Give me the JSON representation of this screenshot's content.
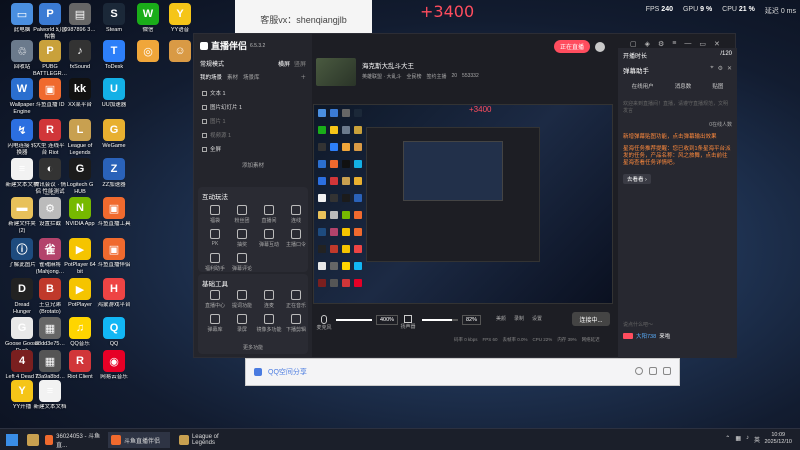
{
  "overlay": {
    "cs_text": "客服vx：shenqiangjlb",
    "big_number": "+3400",
    "perf": {
      "fps_label": "FPS",
      "fps": "240",
      "gpu_label": "GPU",
      "gpu": "9 %",
      "cpu_label": "CPU",
      "cpu": "21 %",
      "delay": "延迟 0 ms"
    }
  },
  "desktop_icons": [
    {
      "label": "此电脑",
      "color": "#4a8fe0",
      "glyph": "▭"
    },
    {
      "label": "Palworld 幻兽帕鲁",
      "color": "#3b7bd4",
      "glyph": "P"
    },
    {
      "label": "0987896 3…",
      "color": "#666",
      "glyph": "▤"
    },
    {
      "label": "Steam",
      "color": "#1b2838",
      "glyph": "S"
    },
    {
      "label": "微信",
      "color": "#1aad19",
      "glyph": "W"
    },
    {
      "label": "YY语音",
      "color": "#f5c518",
      "glyph": "Y"
    },
    {
      "label": "回收站",
      "color": "#6b7a8c",
      "glyph": "♲"
    },
    {
      "label": "PUBG BATTLEGR…",
      "color": "#c9a13b",
      "glyph": "P"
    },
    {
      "label": "fxSound",
      "color": "#333",
      "glyph": "♪"
    },
    {
      "label": "ToDesk",
      "color": "#2d7ff9",
      "glyph": "T"
    },
    {
      "label": "",
      "color": "#f0a63a",
      "glyph": "◎"
    },
    {
      "label": "",
      "color": "#d99a45",
      "glyph": "☺"
    },
    {
      "label": "Wallpaper Engine",
      "color": "#2b6fcf",
      "glyph": "W"
    },
    {
      "label": "斗鱼直播 ID",
      "color": "#f06a2e",
      "glyph": "▣"
    },
    {
      "label": "XX某平台",
      "color": "#111",
      "glyph": "kk"
    },
    {
      "label": "UU加速器",
      "color": "#13b0e6",
      "glyph": "U"
    },
    {
      "label": "闪电连接 转换器",
      "color": "#2c6fe0",
      "glyph": "↯"
    },
    {
      "label": "大型 连线平台 Riot",
      "color": "#d13639",
      "glyph": "R"
    },
    {
      "label": "League of Legends",
      "color": "#c8a050",
      "glyph": "L"
    },
    {
      "label": "WeGame",
      "color": "#e8b030",
      "glyph": "G"
    },
    {
      "label": "新建文本文档",
      "color": "#f2f2f2",
      "glyph": "≡"
    },
    {
      "label": "腾讯会议 · 情侣 性能测试工具",
      "color": "#333",
      "glyph": "◐"
    },
    {
      "label": "Logitech G HUB",
      "color": "#1b1b1b",
      "glyph": "G"
    },
    {
      "label": "ZZ加速器",
      "color": "#2a62b9",
      "glyph": "Z"
    },
    {
      "label": "新建文件夹 (2)",
      "color": "#e8c15a",
      "glyph": "▬"
    },
    {
      "label": "设置拦截",
      "color": "#bbb",
      "glyph": "⚙"
    },
    {
      "label": "NVIDIA App",
      "color": "#76b900",
      "glyph": "N"
    },
    {
      "label": "斗鱼直播工具",
      "color": "#f06a2e",
      "glyph": "▣"
    },
    {
      "label": "了解此图片",
      "color": "#1e4b7e",
      "glyph": "ⓘ"
    },
    {
      "label": "雀魂麻将 (Mahjong…",
      "color": "#b3436b",
      "glyph": "雀"
    },
    {
      "label": "PotPlayer 64 bit",
      "color": "#f5c400",
      "glyph": "▶"
    },
    {
      "label": "斗鱼直播伴侣",
      "color": "#f06a2e",
      "glyph": "▣"
    },
    {
      "label": "Dread Hunger",
      "color": "#222",
      "glyph": "D"
    },
    {
      "label": "土豆兄弟 (Brotato)",
      "color": "#c0392b",
      "glyph": "B"
    },
    {
      "label": "PotPlayer",
      "color": "#f5c400",
      "glyph": "▶"
    },
    {
      "label": "鸿蒙游戏平台",
      "color": "#e44",
      "glyph": "H"
    },
    {
      "label": "Goose Goose Duck",
      "color": "#e8e8e8",
      "glyph": "G"
    },
    {
      "label": "88dd3e75…",
      "color": "#666",
      "glyph": "▦"
    },
    {
      "label": "QQ音乐",
      "color": "#ffd500",
      "glyph": "♫"
    },
    {
      "label": "QQ",
      "color": "#12b7f5",
      "glyph": "Q"
    },
    {
      "label": "Left 4 Dead 2",
      "color": "#7a1f1f",
      "glyph": "4"
    },
    {
      "label": "73a9a8bd…",
      "color": "#555",
      "glyph": "▦"
    },
    {
      "label": "Riot Client",
      "color": "#d13639",
      "glyph": "R"
    },
    {
      "label": "网易云音乐",
      "color": "#e60026",
      "glyph": "◉"
    },
    {
      "label": "YY开播",
      "color": "#f5c518",
      "glyph": "Y"
    },
    {
      "label": "新建文本文档",
      "color": "#f2f2f2",
      "glyph": "≡"
    }
  ],
  "app": {
    "title": "直播伴侣",
    "version": "6.5.3.2",
    "left": {
      "mode": "常规模式",
      "mode_tabs": [
        "横屏",
        "竖屏"
      ],
      "scene_tabs": [
        "我的场景",
        "素材",
        "场景库"
      ],
      "sources": [
        "文本 1",
        "图片幻灯片 1",
        "图片 1",
        "视频源 1",
        "全屏"
      ],
      "add_source": "添加素材",
      "interact_title": "互动玩法",
      "interact_tools": [
        "福袋",
        "粉丝团",
        "直播间",
        "连线",
        "PK",
        "抽奖",
        "弹幕互动",
        "主播口令",
        "福利助手",
        "弹幕评论"
      ],
      "basic_title": "基础工具",
      "basic_tools": [
        "直播中心",
        "提词功能",
        "连麦",
        "正在音乐",
        "弹幕库",
        "录屏",
        "镜像多功能",
        "下播剪辑"
      ],
      "more": "更多功能"
    },
    "header": {
      "stream_title": "海克斯大乱斗大王",
      "category": "英雄联盟 · 大乱斗",
      "badges": [
        "全民榜",
        "签约主播"
      ],
      "stats": [
        "20",
        "553332"
      ],
      "live_btn": "正在直播",
      "right_tabs": [
        "开播时长",
        "/120"
      ]
    },
    "bottom": {
      "mic_label": "麦克风",
      "mic_vol": "400%",
      "spk_label": "扬声器",
      "spk_vol": "82%",
      "tools": [
        "美颜",
        "录制",
        "设置"
      ],
      "connect_btn": "连接中...",
      "status": [
        "码率 0 kbps",
        "FPS 60",
        "丢帧率 0.0%",
        "CPU 22%",
        "内存 39%",
        "网络延迟"
      ]
    },
    "chat": {
      "title": "弹幕助手",
      "tabs": [
        "在线用户",
        "消息数",
        "贴图"
      ],
      "lines": [
        "欢迎来到直播间！直播，请遵守直播规范，文明发言",
        "新增弹幕贴图功能，点击弹幕输出效果",
        "星海任务推荐提醒：您已收到1条星海平台派发的任务，产品名称：风之旅舞，点击前往星海查看任务详情吧。"
      ],
      "go_btn": "去看看 ›",
      "input_placeholder": "说点什么吧～",
      "user": "大阳738",
      "user_suffix": "来啦",
      "online": "0在线人数"
    }
  },
  "behind_window": {
    "url_text": "QQ空间分享",
    "bar_text": ""
  },
  "taskbar": {
    "items": [
      "36024053 - 斗鱼直...",
      "斗鱼直播伴侣",
      "League of Legends"
    ],
    "time": "10:09",
    "date": "2025/12/10",
    "lang": "英"
  }
}
